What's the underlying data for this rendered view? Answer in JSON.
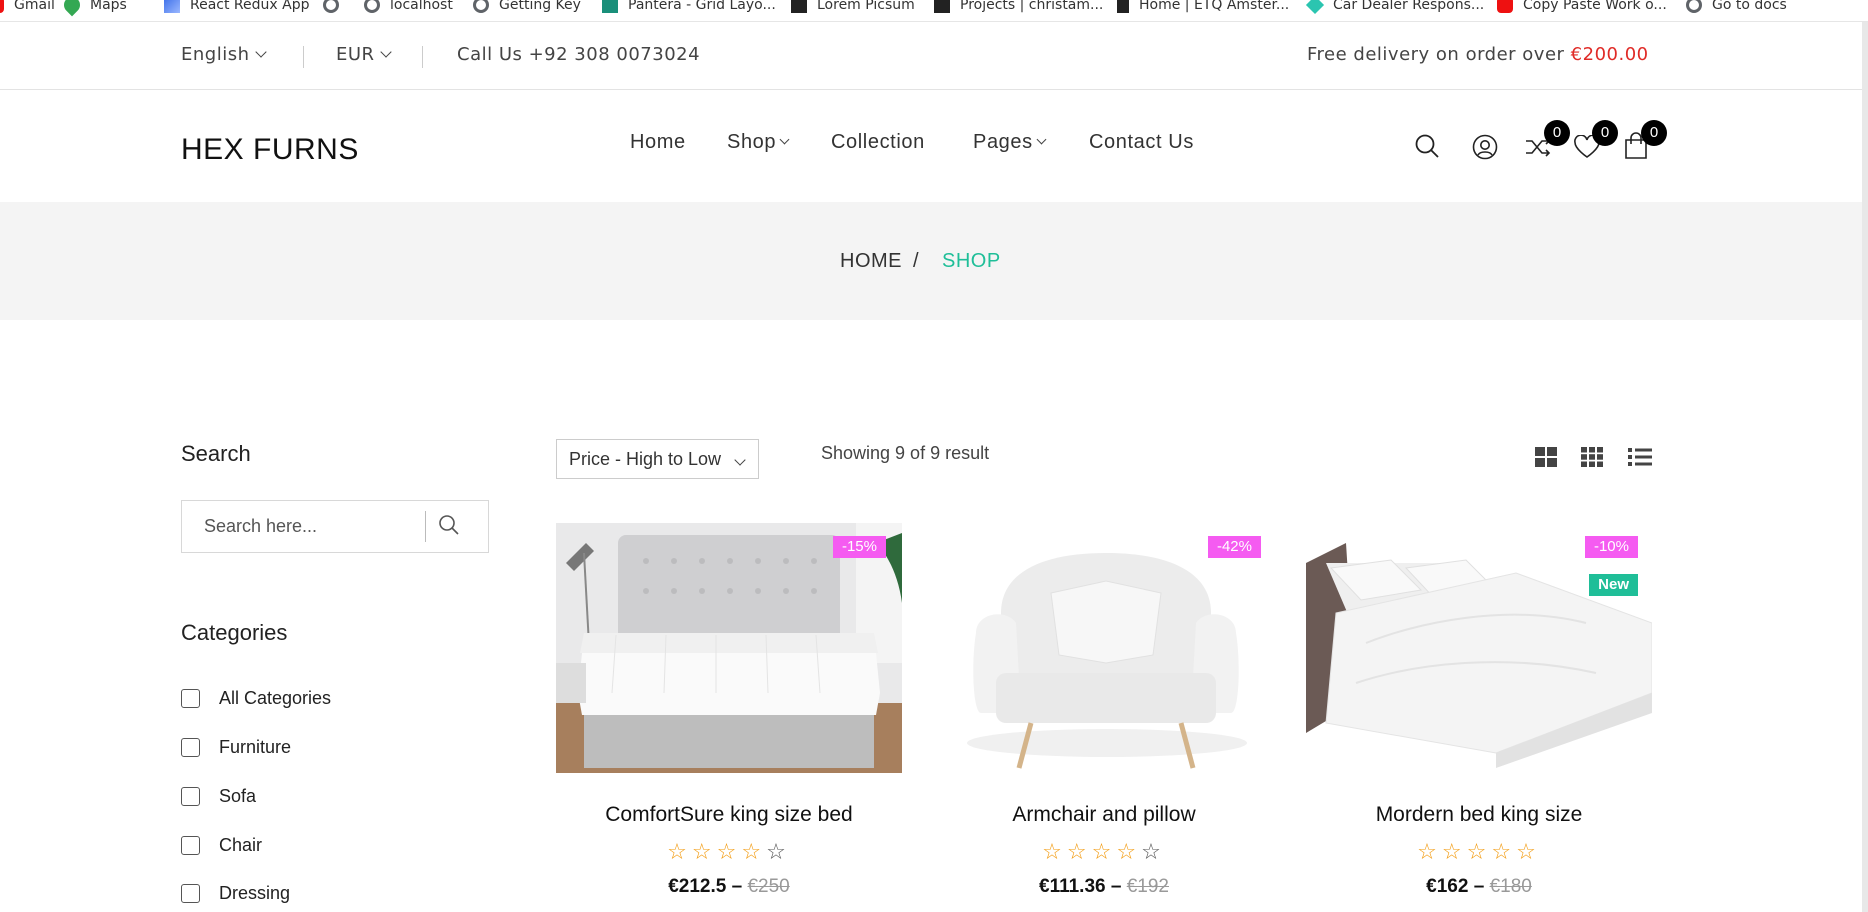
{
  "bookmarks": [
    "Gmail",
    "Maps",
    "React Redux App",
    "",
    "localhost",
    "Getting Key",
    "Pantera - Grid Layo...",
    "Lorem Picsum",
    "Projects | christam...",
    "Home | ETQ Amster...",
    "Car Dealer Respons...",
    "Copy Paste Work o...",
    "Go to docs"
  ],
  "topbar": {
    "language": "English",
    "currency": "EUR",
    "phone": "Call Us +92 308 0073024",
    "delivery_text": "Free delivery on order over",
    "delivery_amount": "€200.00",
    "accent_color": "#e02b27"
  },
  "header": {
    "logo": "HEX FURNS",
    "nav": [
      "Home",
      "Shop",
      "Collection",
      "Pages",
      "Contact Us"
    ],
    "compare_count": "0",
    "wishlist_count": "0",
    "cart_count": "0"
  },
  "breadcrumb": {
    "home": "HOME",
    "separator": "/",
    "current": "SHOP",
    "current_color": "#1fbe98"
  },
  "sidebar": {
    "search_title": "Search",
    "search_placeholder": "Search here...",
    "categories_title": "Categories",
    "categories": [
      "All Categories",
      "Furniture",
      "Sofa",
      "Chair",
      "Dressing"
    ]
  },
  "toolbar": {
    "sort_selected": "Price - High to Low",
    "showing": "Showing 9 of 9 result"
  },
  "products": [
    {
      "name": "ComfortSure king size bed",
      "price": "€212.5",
      "old_price": "€250",
      "discount": "-15%",
      "is_new": false,
      "rating": 4
    },
    {
      "name": "Armchair and pillow",
      "price": "€111.36",
      "old_price": "€192",
      "discount": "-42%",
      "is_new": false,
      "rating": 4
    },
    {
      "name": "Mordern bed king size",
      "price": "€162",
      "old_price": "€180",
      "discount": "-10%",
      "is_new": true,
      "new_label": "New",
      "rating": 5
    }
  ],
  "colors": {
    "star": "#f39c12",
    "star_empty": "#555555",
    "sale_tag": "#f55bf1",
    "new_tag": "#1fbe98"
  }
}
